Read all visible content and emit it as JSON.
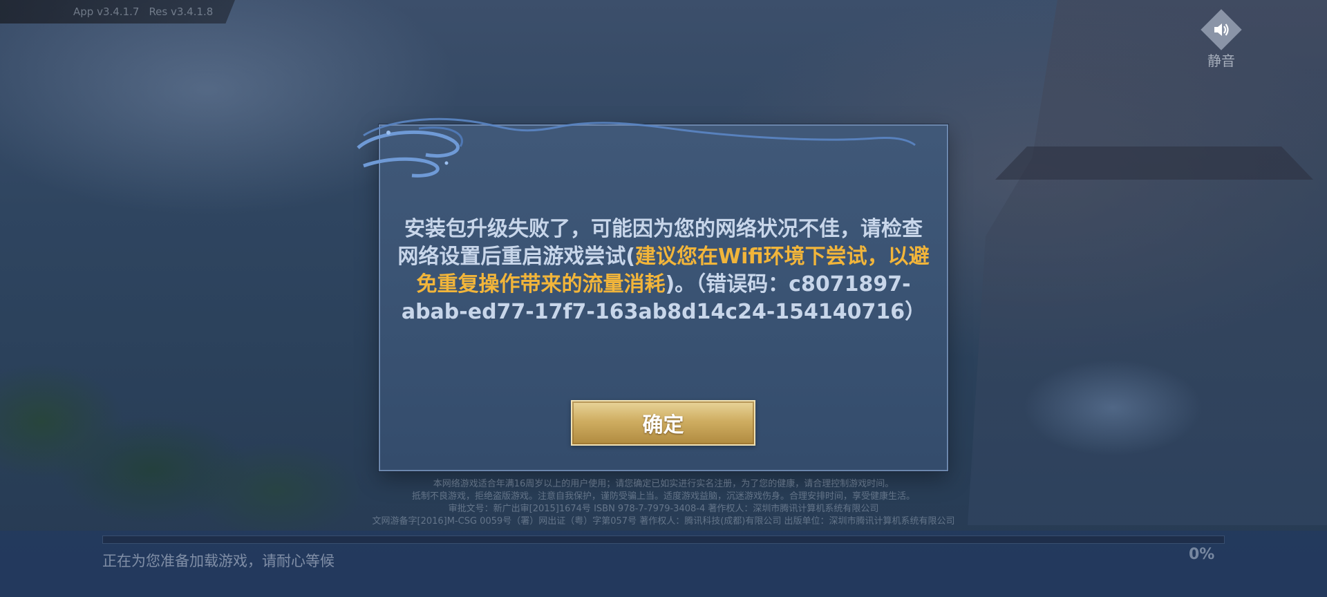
{
  "version": {
    "app": "App v3.4.1.7",
    "res": "Res v3.4.1.8"
  },
  "mute": {
    "icon": "speaker-icon",
    "label": "静音"
  },
  "dialog": {
    "message_before": "安装包升级失败了，可能因为您的网络状况不佳，请检查网络设置后重启游戏尝试(",
    "message_highlight": "建议您在Wifi环境下尝试，以避免重复操作带来的流量消耗",
    "message_after": ")。（错误码：c8071897-abab-ed77-17f7-163ab8d14c24-154140716）",
    "confirm_label": "确定"
  },
  "legal": {
    "lines": [
      "本网络游戏适合年满16周岁以上的用户使用；请您确定已如实进行实名注册，为了您的健康，请合理控制游戏时间。",
      "抵制不良游戏，拒绝盗版游戏。注意自我保护，谨防受骗上当。适度游戏益脑，沉迷游戏伤身。合理安排时间，享受健康生活。",
      "审批文号：新广出审[2015]1674号 ISBN 978-7-7979-3408-4 著作权人：深圳市腾讯计算机系统有限公司",
      "文网游备字[2016]M-CSG 0059号（署）网出证（粤）字第057号 著作权人：腾讯科技(成都)有限公司 出版单位：深圳市腾讯计算机系统有限公司"
    ]
  },
  "loading": {
    "status": "正在为您准备加载游戏，请耐心等候",
    "percent_text": "0%",
    "progress": 0
  },
  "colors": {
    "highlight": "#f2b53a",
    "message": "#c8d6ea",
    "button_gold": "#cfae62"
  }
}
